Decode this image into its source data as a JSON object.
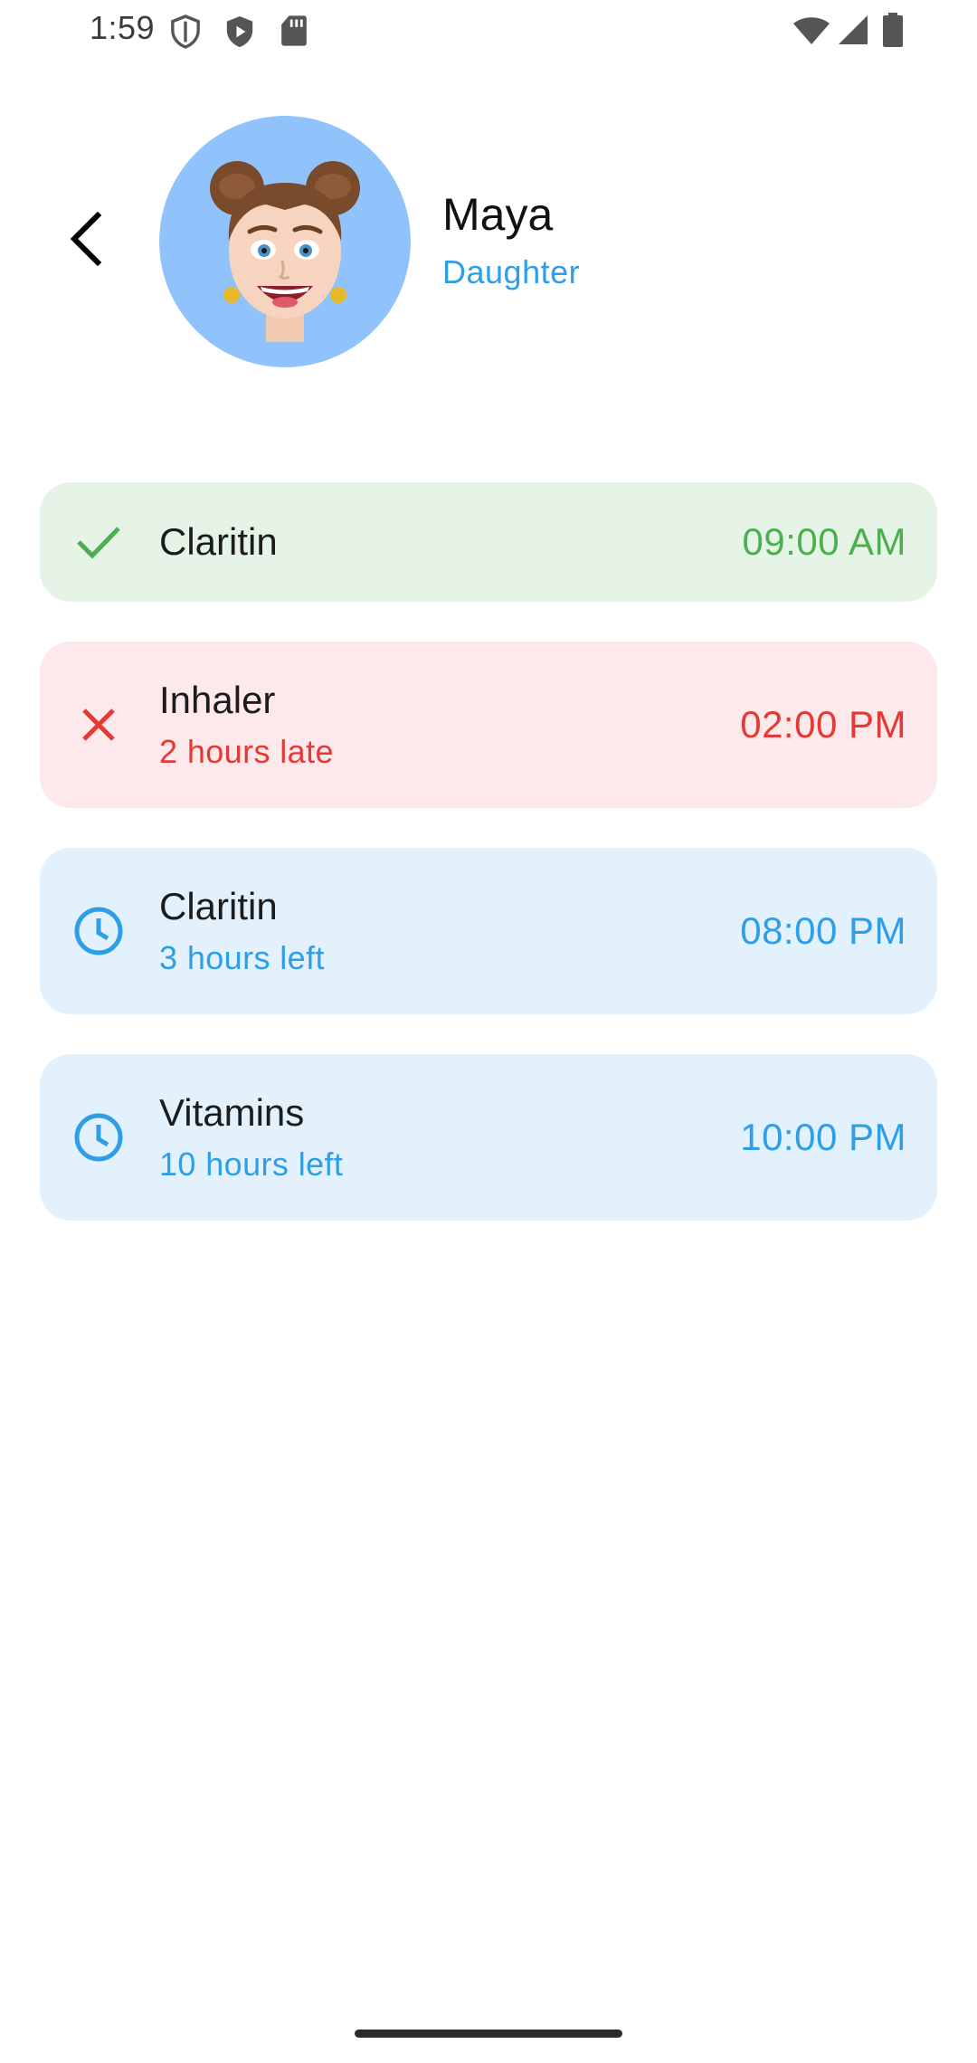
{
  "status_bar": {
    "time": "1:59",
    "left_icons": [
      "shield-outline-icon",
      "shield-play-icon",
      "sd-card-icon"
    ],
    "right_icons": [
      "wifi-icon",
      "cell-signal-icon",
      "battery-icon"
    ]
  },
  "header": {
    "back_icon": "chevron-left-icon",
    "avatar": "memoji-girl-avatar",
    "avatar_bg": "#90c2fb",
    "name": "Maya",
    "relation": "Daughter"
  },
  "doses": [
    {
      "state": "taken",
      "icon": "check-icon",
      "name": "Claritin",
      "status": "",
      "time": "09:00 AM"
    },
    {
      "state": "missed",
      "icon": "close-icon",
      "name": "Inhaler",
      "status": "2 hours late",
      "time": "02:00 PM"
    },
    {
      "state": "upcoming",
      "icon": "clock-icon",
      "name": "Claritin",
      "status": "3 hours left",
      "time": "08:00 PM"
    },
    {
      "state": "upcoming",
      "icon": "clock-icon",
      "name": "Vitamins",
      "status": "10 hours left",
      "time": "10:00 PM"
    }
  ],
  "colors": {
    "taken_bg": "#e6f4e7",
    "taken_accent": "#4caf50",
    "missed_bg": "#fde8eb",
    "missed_accent": "#e53935",
    "upcoming_bg": "#e2f1fc",
    "upcoming_accent": "#2e9fe6"
  }
}
